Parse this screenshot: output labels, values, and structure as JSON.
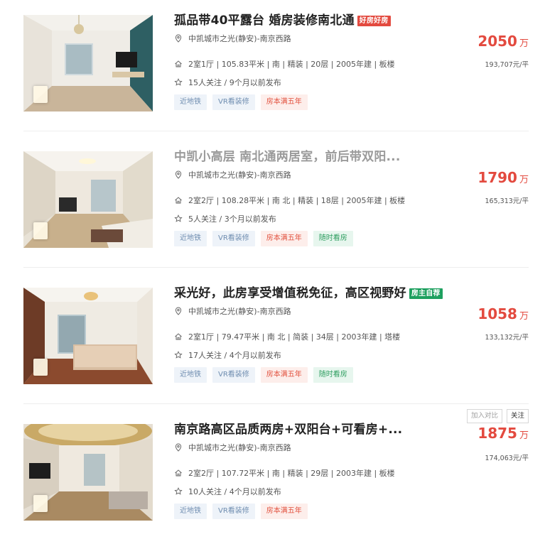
{
  "listings": [
    {
      "title": "孤品带40平露台 婚房装修南北通",
      "title_tag": "好房好房",
      "title_tag_color": "#e34a3f",
      "title_dim": false,
      "community": "中凯城市之光(静安)",
      "separator": " - ",
      "district": "南京西路",
      "info": "2室1厅 | 105.83平米 | 南 | 精装 | 20层 | 2005年建 | 板楼",
      "follow": "15人关注 / 9个月以前发布",
      "chips": [
        {
          "label": "近地铁",
          "style": "blue"
        },
        {
          "label": "VR看装修",
          "style": "blue"
        },
        {
          "label": "房本满五年",
          "style": "red"
        }
      ],
      "price": "2050",
      "price_unit": "万",
      "unit_price": "193,707元/平",
      "buttons": []
    },
    {
      "title": "中凯小高层 南北通两居室，前后带双阳...",
      "title_tag": "",
      "title_dim": true,
      "community": "中凯城市之光(静安)",
      "separator": " - ",
      "district": "南京西路",
      "info": "2室2厅 | 108.28平米 | 南 北 | 精装 | 18层 | 2005年建 | 板楼",
      "follow": "5人关注 / 3个月以前发布",
      "chips": [
        {
          "label": "近地铁",
          "style": "blue"
        },
        {
          "label": "VR看装修",
          "style": "blue"
        },
        {
          "label": "房本满五年",
          "style": "red"
        },
        {
          "label": "随时看房",
          "style": "green"
        }
      ],
      "price": "1790",
      "price_unit": "万",
      "unit_price": "165,313元/平",
      "buttons": []
    },
    {
      "title": "采光好，此房享受增值税免征，高区视野好",
      "title_tag": "房主自荐",
      "title_tag_color": "#1ea05f",
      "title_dim": false,
      "community": "中凯城市之光(静安)",
      "separator": " - ",
      "district": "南京西路",
      "info": "2室1厅 | 79.47平米 | 南 北 | 简装 | 34层 | 2003年建 | 塔楼",
      "follow": "17人关注 / 4个月以前发布",
      "chips": [
        {
          "label": "近地铁",
          "style": "blue"
        },
        {
          "label": "VR看装修",
          "style": "blue"
        },
        {
          "label": "房本满五年",
          "style": "red"
        },
        {
          "label": "随时看房",
          "style": "green"
        }
      ],
      "price": "1058",
      "price_unit": "万",
      "unit_price": "133,132元/平",
      "buttons": []
    },
    {
      "title": "南京路高区品质两房+双阳台+可看房+...",
      "title_tag": "",
      "title_dim": false,
      "community": "中凯城市之光(静安)",
      "separator": " - ",
      "district": "南京西路",
      "info": "2室2厅 | 107.72平米 | 南 | 精装 | 29层 | 2003年建 | 板楼",
      "follow": "10人关注 / 4个月以前发布",
      "chips": [
        {
          "label": "近地铁",
          "style": "blue"
        },
        {
          "label": "VR看装修",
          "style": "blue"
        },
        {
          "label": "房本满五年",
          "style": "red"
        }
      ],
      "price": "1875",
      "price_unit": "万",
      "unit_price": "174,063元/平",
      "buttons": [
        "加入对比",
        "关注"
      ]
    }
  ],
  "icons": {
    "location": "location-pin-icon",
    "house": "house-icon",
    "star": "star-icon"
  },
  "colors": {
    "price_red": "#e34a3f",
    "chip_blue": "#6f8db0",
    "chip_red": "#e2523f",
    "chip_green": "#2d9d5f"
  }
}
